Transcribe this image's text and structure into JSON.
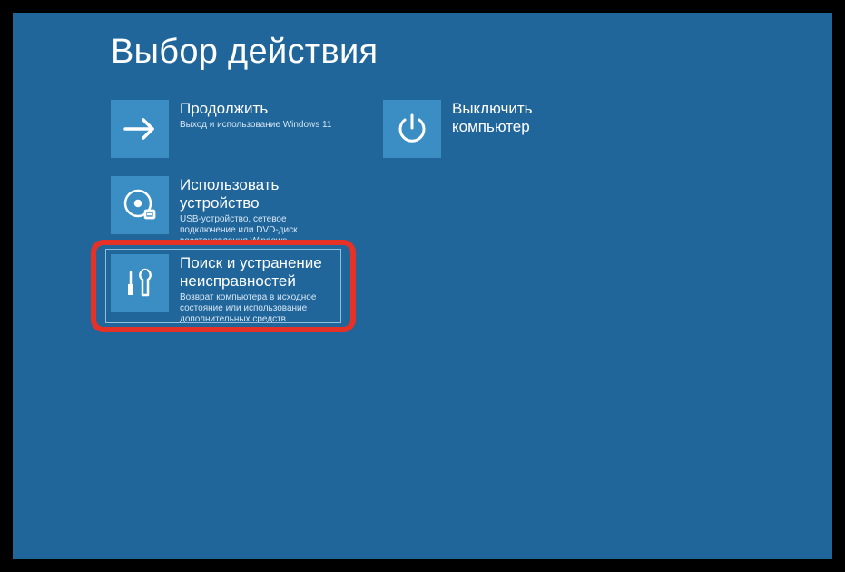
{
  "title": "Выбор действия",
  "tiles": {
    "continue": {
      "title": "Продолжить",
      "desc": "Выход и использование Windows 11"
    },
    "shutdown": {
      "title": "Выключить компьютер",
      "desc": ""
    },
    "device": {
      "title": "Использовать устройство",
      "desc": "USB-устройство, сетевое подключение или DVD-диск восстановления Windows"
    },
    "trouble": {
      "title": "Поиск и устранение неисправностей",
      "desc": "Возврат компьютера в исходное состояние или использование дополнительных средств"
    }
  }
}
